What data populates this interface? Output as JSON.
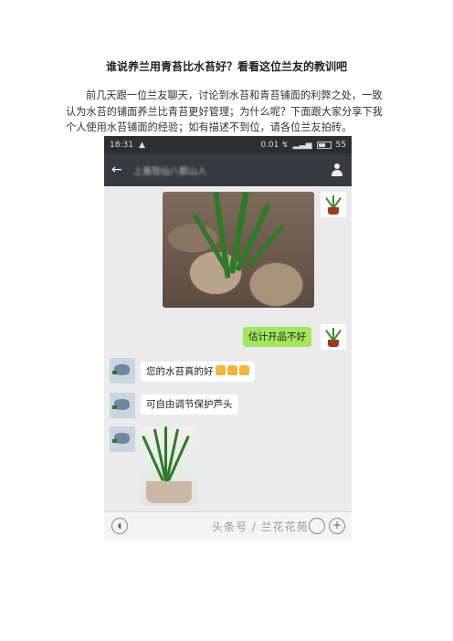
{
  "article": {
    "title": "谁说养兰用青苔比水苔好？看看这位兰友的教训吧",
    "paragraph": "前几天跟一位兰友聊天，讨论到水苔和青苔铺面的利弊之处，一致认为水苔的铺面养兰比青苔更好管理；为什么呢？下面跟大家分享下我个人使用水苔铺面的经验；如有描述不到位，请各位兰友拍砖。"
  },
  "phone": {
    "status": {
      "time": "18:31",
      "speed": "0.01 ↯",
      "battery": "55"
    },
    "chat_title": "上善隐仙八都山人",
    "messages": [
      {
        "text": "估计开品不好"
      },
      {
        "text": "您的水苔真的好"
      },
      {
        "text": "可自由调节保护芦头"
      }
    ],
    "watermark": "头条号 / 兰花花苑"
  },
  "icons": [
    "back-arrow-icon",
    "person-icon",
    "voice-icon",
    "emoji-icon",
    "plus-icon"
  ],
  "colors": {
    "bubble_green": "#a0e75a",
    "nav_bar": "#393a3f",
    "chat_bg": "#ebebeb"
  }
}
